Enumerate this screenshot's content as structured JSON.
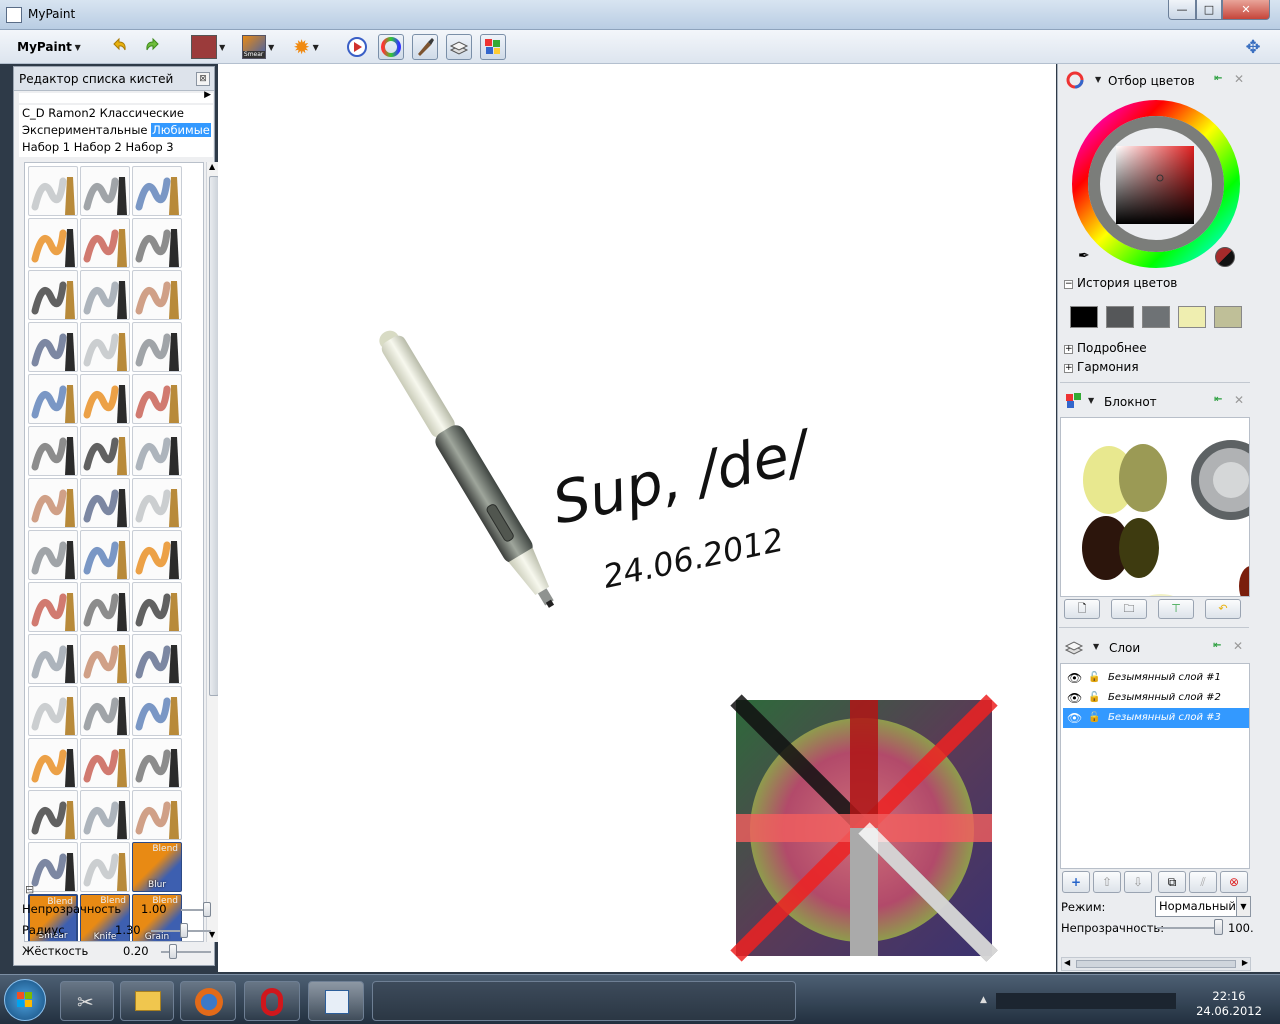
{
  "window": {
    "title": "MyPaint",
    "min": "—",
    "max": "□",
    "close": "✕"
  },
  "toolbar": {
    "menu_label": "MyPaint",
    "current_color": "#9b3b3b",
    "current_brush_label": "Smear"
  },
  "brush_panel": {
    "title": "Редактор списка кистей",
    "close": "⊠",
    "groups_rows": [
      [
        "C_D",
        "Ramon2",
        "Классические"
      ],
      [
        "Экспериментальные",
        "Любимые"
      ],
      [
        "Набор 1",
        "Набор 2",
        "Набор 3"
      ]
    ],
    "selected_group": "Любимые",
    "blend_brushes": [
      {
        "top": "Blend",
        "label": "Blur"
      },
      {
        "top": "Blend",
        "label": "Smear"
      },
      {
        "top": "Blend",
        "label": "Knife"
      },
      {
        "top": "Blend",
        "label": "Grain"
      }
    ],
    "collapse": "⊟",
    "opacity": {
      "label": "Непрозрачность",
      "value": "1.00",
      "level": 1.0
    },
    "radius": {
      "label": "Радиус",
      "value": "1.30",
      "level": 0.55
    },
    "hardness": {
      "label": "Жёсткость",
      "value": "0.20",
      "level": 0.2
    }
  },
  "canvas": {
    "handwriting_line1": "Sup, /de/",
    "handwriting_line2": "24.06.2012"
  },
  "color_panel": {
    "title": "Отбор цветов",
    "history_title": "История цветов",
    "history_colors": [
      "#000000",
      "#555759",
      "#6e7275",
      "#efeeb0",
      "#bfbf98"
    ],
    "details_label": "Подробнее",
    "harmony_label": "Гармония"
  },
  "scratchpad": {
    "title": "Блокнот",
    "buttons": [
      "new",
      "open",
      "save",
      "revert"
    ]
  },
  "layers_panel": {
    "title": "Слои",
    "layers": [
      {
        "name": "Безымянный слой #1",
        "selected": false
      },
      {
        "name": "Безымянный слой #2",
        "selected": false
      },
      {
        "name": "Безымянный слой #3",
        "selected": true
      }
    ],
    "mode_label": "Режим:",
    "mode_value": "Нормальный",
    "opacity_label": "Непрозрачность:",
    "opacity_value": "100."
  },
  "taskbar": {
    "time": "22:16",
    "date": "24.06.2012"
  }
}
